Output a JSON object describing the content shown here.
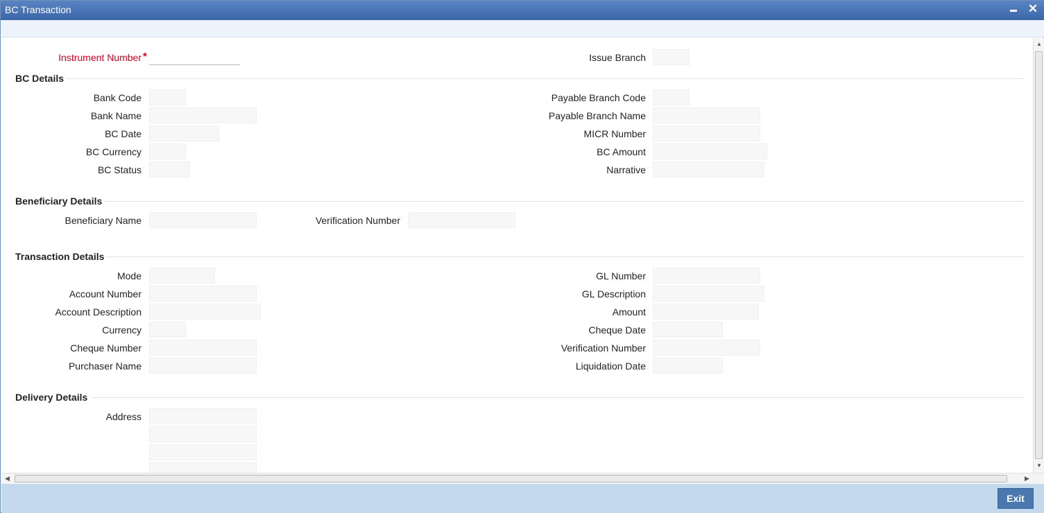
{
  "window": {
    "title": "BC Transaction"
  },
  "top": {
    "instrument_number_label": "Instrument Number",
    "required_mark": "*",
    "issue_branch_label": "Issue Branch"
  },
  "bc_details": {
    "heading": "BC Details",
    "bank_code": "Bank Code",
    "bank_name": "Bank Name",
    "bc_date": "BC Date",
    "bc_currency": "BC Currency",
    "bc_status": "BC Status",
    "payable_branch_code": "Payable Branch Code",
    "payable_branch_name": "Payable Branch Name",
    "micr_number": "MICR Number",
    "bc_amount": "BC Amount",
    "narrative": "Narrative"
  },
  "beneficiary_details": {
    "heading": "Beneficiary Details",
    "beneficiary_name": "Beneficiary Name",
    "verification_number": "Verification Number"
  },
  "transaction_details": {
    "heading": "Transaction Details",
    "mode": "Mode",
    "account_number": "Account Number",
    "account_description": "Account Description",
    "currency": "Currency",
    "cheque_number": "Cheque Number",
    "purchaser_name": "Purchaser Name",
    "gl_number": "GL Number",
    "gl_description": "GL Description",
    "amount": "Amount",
    "cheque_date": "Cheque Date",
    "verification_number": "Verification Number",
    "liquidation_date": "Liquidation Date"
  },
  "delivery_details": {
    "heading": "Delivery Details",
    "address": "Address"
  },
  "footer": {
    "exit_label": "Exit"
  },
  "icons": {
    "minimize": "minimize-icon",
    "close": "close-icon"
  }
}
